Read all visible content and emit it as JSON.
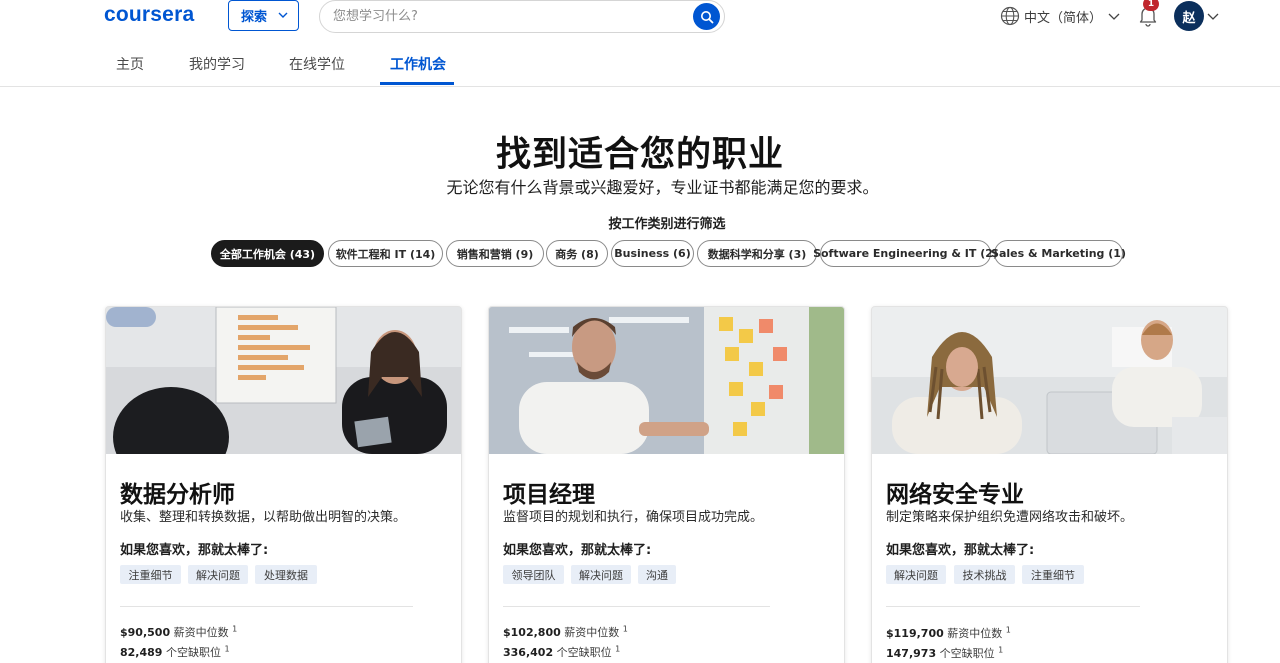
{
  "header": {
    "logo": "coursera",
    "explore_label": "探索",
    "search_placeholder": "您想学习什么?",
    "language_label": "中文（简体）",
    "notification_count": "1",
    "avatar_initial": "赵"
  },
  "nav": {
    "tabs": [
      {
        "label": "主页",
        "active": false
      },
      {
        "label": "我的学习",
        "active": false
      },
      {
        "label": "在线学位",
        "active": false
      },
      {
        "label": "工作机会",
        "active": true
      }
    ]
  },
  "hero": {
    "title": "找到适合您的职业",
    "subtitle": "无论您有什么背景或兴趣爱好，专业证书都能满足您的要求。",
    "filter_title": "按工作类别进行筛选"
  },
  "filters": [
    {
      "label": "全部工作机会 (43)",
      "active": true
    },
    {
      "label": "软件工程和 IT (14)",
      "active": false
    },
    {
      "label": "销售和营销 (9)",
      "active": false
    },
    {
      "label": "商务 (8)",
      "active": false
    },
    {
      "label": "Business (6)",
      "active": false
    },
    {
      "label": "数据科学和分享 (3)",
      "active": false
    },
    {
      "label": "Software Engineering & IT (2)",
      "active": false
    },
    {
      "label": "Sales & Marketing (1)",
      "active": false
    }
  ],
  "cards": [
    {
      "title": "数据分析师",
      "description": "收集、整理和转换数据，以帮助做出明智的决策。",
      "like_label": "如果您喜欢，那就太棒了:",
      "tags": [
        "注重细节",
        "解决问题",
        "处理数据"
      ],
      "salary": "$90,500",
      "salary_label": "薪资中位数",
      "jobs": "82,489",
      "jobs_label": "个空缺职位",
      "footnote": "1"
    },
    {
      "title": "项目经理",
      "description": "监督项目的规划和执行，确保项目成功完成。",
      "like_label": "如果您喜欢，那就太棒了:",
      "tags": [
        "领导团队",
        "解决问题",
        "沟通"
      ],
      "salary": "$102,800",
      "salary_label": "薪资中位数",
      "jobs": "336,402",
      "jobs_label": "个空缺职位",
      "footnote": "1"
    },
    {
      "title": "网络安全专业",
      "description": "制定策略来保护组织免遭网络攻击和破坏。",
      "like_label": "如果您喜欢，那就太棒了:",
      "tags": [
        "解决问题",
        "技术挑战",
        "注重细节"
      ],
      "salary": "$119,700",
      "salary_label": "薪资中位数",
      "jobs": "147,973",
      "jobs_label": "个空缺职位",
      "footnote": "1"
    }
  ],
  "colors": {
    "brand": "#0056d2",
    "badge": "#c0272d",
    "avatar": "#0b2f5c",
    "tag_bg": "#e8eef7"
  }
}
